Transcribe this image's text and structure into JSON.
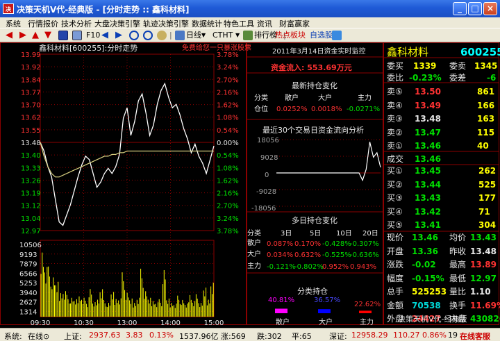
{
  "window": {
    "title": "决策天机V代-经典版 - [分时走势 :: 鑫科材料]",
    "app_icon": "决",
    "min": "_",
    "max": "□",
    "close": "×"
  },
  "menu": [
    "系统",
    "行情报价",
    "技术分析",
    "大盘决策引擎",
    "轨迹决策引擎",
    "数据统计",
    "特色工具",
    "资讯",
    "财富赢家"
  ],
  "toolbar": {
    "f10": "F10",
    "period": "日线",
    "ctht": "CTHT",
    "rank": "排行榜",
    "hot": "热点板块",
    "pick": "自选股"
  },
  "chart": {
    "header": "鑫科材料[600255]:分时走势",
    "promo": "免费给您一只暴涨股票",
    "price_ticks": [
      "13.99",
      "13.92",
      "13.84",
      "13.77",
      "13.70",
      "13.62",
      "13.55",
      "13.48",
      "13.40",
      "13.33",
      "13.26",
      "13.19",
      "13.12",
      "13.04",
      "12.97"
    ],
    "pct_ticks": [
      "3.78%",
      "3.24%",
      "2.70%",
      "2.16%",
      "1.62%",
      "1.08%",
      "0.54%",
      "0.00%",
      "0.54%",
      "1.08%",
      "1.62%",
      "2.16%",
      "2.70%",
      "3.24%",
      "3.78%"
    ],
    "vol_ticks": [
      "10506",
      "9193",
      "7879",
      "6566",
      "5253",
      "3940",
      "2627",
      "1314"
    ],
    "time_ticks": [
      "09:30",
      "10:30",
      "13:00",
      "14:00",
      "15:00"
    ]
  },
  "chart_data": {
    "type": "line",
    "title": "鑫科材料[600255]:分时走势",
    "prev_close": 13.48,
    "ylim": [
      12.97,
      13.99
    ],
    "price": [
      13.48,
      13.43,
      13.34,
      13.28,
      13.15,
      13.02,
      13.0,
      13.06,
      13.12,
      13.2,
      13.28,
      13.35,
      13.4,
      13.38,
      13.3,
      13.22,
      13.25,
      13.3,
      13.33,
      13.3,
      13.34,
      13.41,
      13.62,
      13.68,
      13.52,
      13.6,
      13.72,
      13.76,
      13.65,
      13.52,
      13.58,
      13.7,
      13.78,
      13.82,
      13.74,
      13.68,
      13.7,
      13.64,
      13.56,
      13.5,
      13.42,
      13.47,
      13.4,
      13.36,
      13.3,
      13.38,
      13.46
    ],
    "avg": [
      13.48,
      13.4,
      13.34,
      13.3,
      13.28,
      13.28,
      13.29,
      13.3,
      13.31,
      13.32,
      13.33,
      13.34,
      13.35,
      13.36,
      13.37,
      13.38,
      13.39,
      13.4,
      13.4,
      13.41,
      13.41,
      13.42,
      13.42,
      13.43,
      13.43,
      13.43,
      13.43,
      13.43,
      13.43,
      13.43,
      13.43,
      13.43,
      13.43,
      13.43,
      13.43,
      13.43,
      13.43,
      13.43,
      13.43,
      13.43,
      13.43,
      13.43,
      13.43,
      13.43,
      13.43,
      13.43,
      13.43
    ],
    "volume": [
      9800,
      7600,
      6900,
      5400,
      4800,
      3600,
      3900,
      3000,
      2600,
      2400,
      3100,
      2900,
      2200,
      3800,
      2000,
      2600,
      4200,
      2300,
      1900,
      3400,
      2700,
      2800,
      6100,
      3300,
      2500,
      2100,
      2900,
      6600,
      3500,
      2600,
      2400,
      2200,
      2400,
      6400,
      2500,
      2100,
      2000,
      2900,
      2300,
      1800,
      3300,
      2400,
      3100,
      1900,
      4000,
      2600,
      5200
    ]
  },
  "monitor": {
    "date": "2011年3月14日资金实时监控",
    "inflow_label": "资金流入:",
    "inflow": "553.69万元",
    "latest_title": "最新持仓变化",
    "cols": [
      "分类",
      "散户",
      "大户",
      "主力"
    ],
    "row_label": "仓位",
    "row": [
      "0.0252%",
      "0.0018%",
      "-0.0271%"
    ],
    "flow_title": "最近30个交易日资金流向分析",
    "flow_ticks": [
      "18056",
      "9028",
      "0",
      "-9028",
      "-18056"
    ],
    "flow_values": [
      0,
      0,
      0,
      0,
      0,
      0,
      0,
      0,
      0,
      0,
      0,
      0,
      0,
      0,
      0,
      0,
      0,
      0,
      0,
      0,
      0,
      0,
      0,
      0,
      -4000,
      2000,
      16800,
      8500,
      11000,
      3000
    ],
    "multi_title": "多日持仓变化",
    "multi_cols": [
      "分类",
      "3日",
      "5日",
      "10日",
      "20日"
    ],
    "multi_rows": [
      {
        "name": "散户",
        "v": [
          "0.087%",
          "0.170%",
          "-0.428%",
          "-0.307%"
        ]
      },
      {
        "name": "大户",
        "v": [
          "0.034%",
          "0.632%",
          "-0.525%",
          "-0.636%"
        ]
      },
      {
        "name": "主力",
        "v": [
          "-0.121%",
          "-0.802%",
          "0.952%",
          "0.943%"
        ]
      }
    ],
    "hold_title": "分类持仓",
    "hold": [
      {
        "name": "散户",
        "pct": "40.81%",
        "value": 40.81,
        "color": "#ff00ff"
      },
      {
        "name": "大户",
        "pct": "36.57%",
        "value": 36.57,
        "color": "#0000ff"
      },
      {
        "name": "主力",
        "pct": "22.62%",
        "value": 22.62,
        "color": "#ff0000"
      }
    ]
  },
  "quote": {
    "name": "鑫科材料",
    "code": "600255",
    "bid_ask": [
      {
        "l": "委买",
        "v": "1339",
        "l2": "委卖",
        "v2": "1345"
      },
      {
        "l": "委比",
        "v": "-0.23%",
        "l2": "委差",
        "v2": "-6"
      }
    ],
    "sells": [
      {
        "l": "卖⑤",
        "p": "13.50",
        "v": "861",
        "c": "red"
      },
      {
        "l": "卖④",
        "p": "13.49",
        "v": "166",
        "c": "red"
      },
      {
        "l": "卖③",
        "p": "13.48",
        "v": "163",
        "c": "wht"
      },
      {
        "l": "卖②",
        "p": "13.47",
        "v": "115",
        "c": "grn"
      },
      {
        "l": "卖①",
        "p": "13.46",
        "v": "40",
        "c": "grn"
      }
    ],
    "deal": {
      "l": "成交",
      "p": "13.46"
    },
    "buys": [
      {
        "l": "买①",
        "p": "13.45",
        "v": "262"
      },
      {
        "l": "买②",
        "p": "13.44",
        "v": "525"
      },
      {
        "l": "买③",
        "p": "13.43",
        "v": "177"
      },
      {
        "l": "买④",
        "p": "13.42",
        "v": "71"
      },
      {
        "l": "买⑤",
        "p": "13.41",
        "v": "304"
      }
    ],
    "stats": [
      {
        "l": "现价",
        "v": "13.46",
        "c": "grn",
        "l2": "均价",
        "v2": "13.43",
        "c2": "grn"
      },
      {
        "l": "开盘",
        "v": "13.36",
        "c": "grn",
        "l2": "昨收",
        "v2": "13.48",
        "c2": "wht"
      },
      {
        "l": "涨跌",
        "v": "-0.02",
        "c": "grn",
        "l2": "最高",
        "v2": "13.89",
        "c2": "red"
      },
      {
        "l": "幅度",
        "v": "-0.15%",
        "c": "grn",
        "l2": "最低",
        "v2": "12.97",
        "c2": "grn"
      },
      {
        "l": "总手",
        "v": "525253",
        "c": "yel",
        "l2": "量比",
        "v2": "1.10",
        "c2": "wht"
      },
      {
        "l": "金额",
        "v": "70538",
        "c": "cyn",
        "l2": "换手",
        "v2": "11.69%",
        "c2": "red"
      },
      {
        "l": "外盘",
        "v": "24427",
        "c": "red",
        "l2": "内盘",
        "v2": "430826",
        "c2": "grn"
      }
    ],
    "watermark": "决策天机V代-经典版"
  },
  "status": {
    "sys": "系统:",
    "online": "在线⊙",
    "sh_label": "上证:",
    "sh": "2937.63",
    "sh_chg": "3.83",
    "sh_pct": "0.13%",
    "sh_amt": "1537.96亿",
    "up": "涨:569",
    "flat": "跌:302",
    "down": "平:65",
    "sz_label": "深证:",
    "sz": "12958.29",
    "sz_chg": "110.27",
    "sz_pct": "0.86%",
    "sz_amt": "19",
    "service": "在线客服"
  }
}
